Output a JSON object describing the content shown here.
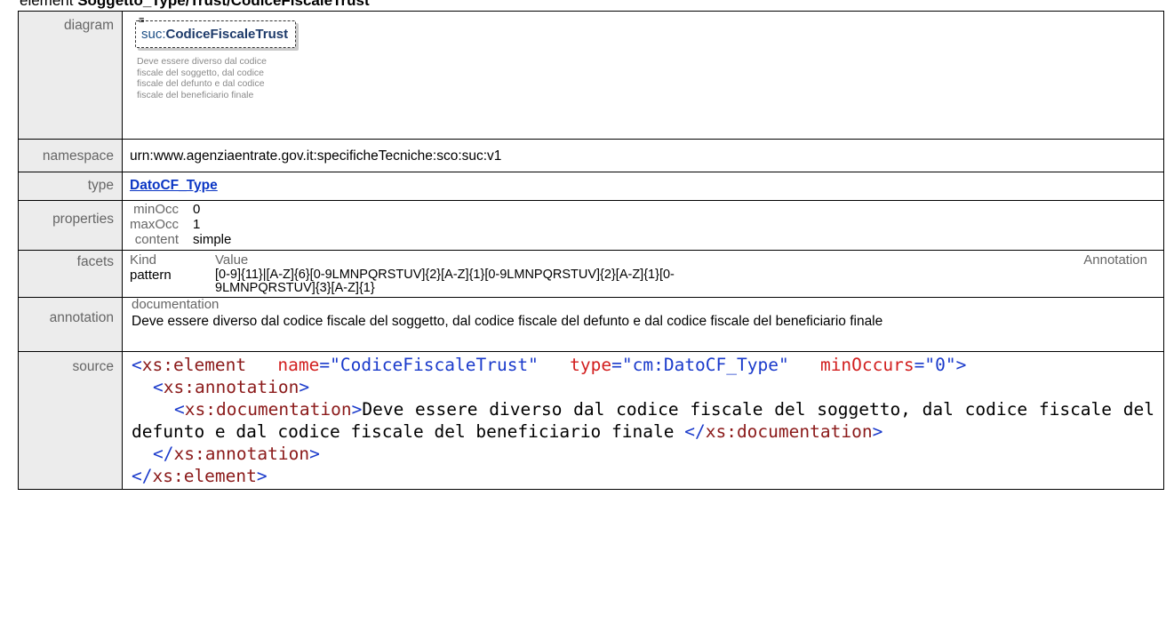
{
  "heading": {
    "prefix": "element ",
    "name": "Soggetto_Type/Trust/CodiceFiscaleTrust"
  },
  "rows": {
    "diagram": {
      "label": "diagram",
      "element_prefix": "suc:",
      "element_name": "CodiceFiscaleTrust",
      "doc_lines": [
        "Deve essere diverso dal codice",
        "fiscale del soggetto, dal codice",
        "fiscale del defunto e dal codice",
        "fiscale del beneficiario finale"
      ]
    },
    "namespace": {
      "label": "namespace",
      "value": "urn:www.agenziaentrate.gov.it:specificheTecniche:sco:suc:v1"
    },
    "type": {
      "label": "type",
      "link": "DatoCF_Type"
    },
    "properties": {
      "label": "properties",
      "items": [
        {
          "key": "minOcc",
          "value": "0"
        },
        {
          "key": "maxOcc",
          "value": "1"
        },
        {
          "key": "content",
          "value": "simple"
        }
      ]
    },
    "facets": {
      "label": "facets",
      "headers": {
        "kind": "Kind",
        "value": "Value",
        "annotation": "Annotation"
      },
      "kind": "pattern",
      "value_line1": "[0-9]{11}|[A-Z]{6}[0-9LMNPQRSTUV]{2}[A-Z]{1}[0-9LMNPQRSTUV]{2}[A-Z]{1}[0-",
      "value_line2": "9LMNPQRSTUV]{3}[A-Z]{1}"
    },
    "annotation": {
      "label": "annotation",
      "header": "documentation",
      "text": "Deve essere diverso dal codice fiscale del soggetto, dal codice fiscale del defunto e dal codice fiscale del beneficiario finale"
    },
    "source": {
      "label": "source",
      "tag_element": "xs:element",
      "attr_name": "name",
      "attr_name_value": "\"CodiceFiscaleTrust\"",
      "attr_type": "type",
      "attr_type_value": "\"cm:DatoCF_Type\"",
      "attr_min": "minOccurs",
      "attr_min_value": "\"0\"",
      "tag_annotation": "xs:annotation",
      "tag_documentation": "xs:documentation",
      "doc_text": "Deve essere diverso dal codice fiscale del soggetto, dal codice fiscale del defunto e dal codice fiscale del beneficiario finale"
    }
  }
}
